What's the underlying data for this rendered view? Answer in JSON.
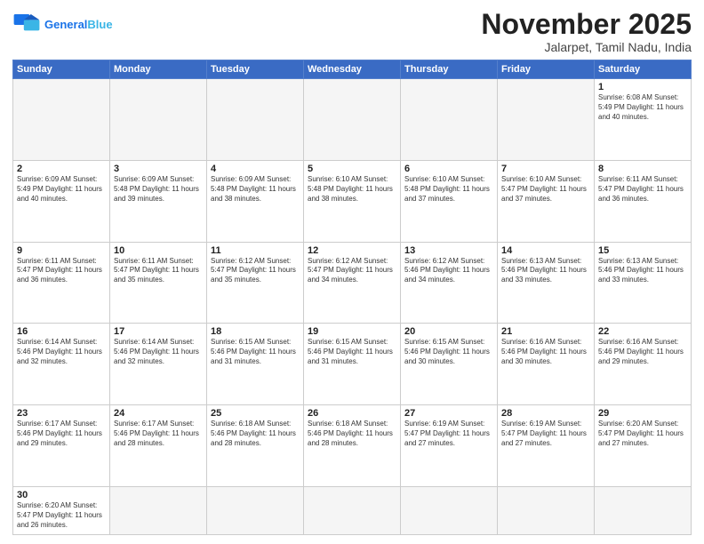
{
  "header": {
    "logo_general": "General",
    "logo_blue": "Blue",
    "month_title": "November 2025",
    "location": "Jalarpet, Tamil Nadu, India"
  },
  "days_of_week": [
    "Sunday",
    "Monday",
    "Tuesday",
    "Wednesday",
    "Thursday",
    "Friday",
    "Saturday"
  ],
  "weeks": [
    [
      {
        "day": "",
        "info": ""
      },
      {
        "day": "",
        "info": ""
      },
      {
        "day": "",
        "info": ""
      },
      {
        "day": "",
        "info": ""
      },
      {
        "day": "",
        "info": ""
      },
      {
        "day": "",
        "info": ""
      },
      {
        "day": "1",
        "info": "Sunrise: 6:08 AM\nSunset: 5:49 PM\nDaylight: 11 hours and 40 minutes."
      }
    ],
    [
      {
        "day": "2",
        "info": "Sunrise: 6:09 AM\nSunset: 5:49 PM\nDaylight: 11 hours and 40 minutes."
      },
      {
        "day": "3",
        "info": "Sunrise: 6:09 AM\nSunset: 5:48 PM\nDaylight: 11 hours and 39 minutes."
      },
      {
        "day": "4",
        "info": "Sunrise: 6:09 AM\nSunset: 5:48 PM\nDaylight: 11 hours and 38 minutes."
      },
      {
        "day": "5",
        "info": "Sunrise: 6:10 AM\nSunset: 5:48 PM\nDaylight: 11 hours and 38 minutes."
      },
      {
        "day": "6",
        "info": "Sunrise: 6:10 AM\nSunset: 5:48 PM\nDaylight: 11 hours and 37 minutes."
      },
      {
        "day": "7",
        "info": "Sunrise: 6:10 AM\nSunset: 5:47 PM\nDaylight: 11 hours and 37 minutes."
      },
      {
        "day": "8",
        "info": "Sunrise: 6:11 AM\nSunset: 5:47 PM\nDaylight: 11 hours and 36 minutes."
      }
    ],
    [
      {
        "day": "9",
        "info": "Sunrise: 6:11 AM\nSunset: 5:47 PM\nDaylight: 11 hours and 36 minutes."
      },
      {
        "day": "10",
        "info": "Sunrise: 6:11 AM\nSunset: 5:47 PM\nDaylight: 11 hours and 35 minutes."
      },
      {
        "day": "11",
        "info": "Sunrise: 6:12 AM\nSunset: 5:47 PM\nDaylight: 11 hours and 35 minutes."
      },
      {
        "day": "12",
        "info": "Sunrise: 6:12 AM\nSunset: 5:47 PM\nDaylight: 11 hours and 34 minutes."
      },
      {
        "day": "13",
        "info": "Sunrise: 6:12 AM\nSunset: 5:46 PM\nDaylight: 11 hours and 34 minutes."
      },
      {
        "day": "14",
        "info": "Sunrise: 6:13 AM\nSunset: 5:46 PM\nDaylight: 11 hours and 33 minutes."
      },
      {
        "day": "15",
        "info": "Sunrise: 6:13 AM\nSunset: 5:46 PM\nDaylight: 11 hours and 33 minutes."
      }
    ],
    [
      {
        "day": "16",
        "info": "Sunrise: 6:14 AM\nSunset: 5:46 PM\nDaylight: 11 hours and 32 minutes."
      },
      {
        "day": "17",
        "info": "Sunrise: 6:14 AM\nSunset: 5:46 PM\nDaylight: 11 hours and 32 minutes."
      },
      {
        "day": "18",
        "info": "Sunrise: 6:15 AM\nSunset: 5:46 PM\nDaylight: 11 hours and 31 minutes."
      },
      {
        "day": "19",
        "info": "Sunrise: 6:15 AM\nSunset: 5:46 PM\nDaylight: 11 hours and 31 minutes."
      },
      {
        "day": "20",
        "info": "Sunrise: 6:15 AM\nSunset: 5:46 PM\nDaylight: 11 hours and 30 minutes."
      },
      {
        "day": "21",
        "info": "Sunrise: 6:16 AM\nSunset: 5:46 PM\nDaylight: 11 hours and 30 minutes."
      },
      {
        "day": "22",
        "info": "Sunrise: 6:16 AM\nSunset: 5:46 PM\nDaylight: 11 hours and 29 minutes."
      }
    ],
    [
      {
        "day": "23",
        "info": "Sunrise: 6:17 AM\nSunset: 5:46 PM\nDaylight: 11 hours and 29 minutes."
      },
      {
        "day": "24",
        "info": "Sunrise: 6:17 AM\nSunset: 5:46 PM\nDaylight: 11 hours and 28 minutes."
      },
      {
        "day": "25",
        "info": "Sunrise: 6:18 AM\nSunset: 5:46 PM\nDaylight: 11 hours and 28 minutes."
      },
      {
        "day": "26",
        "info": "Sunrise: 6:18 AM\nSunset: 5:46 PM\nDaylight: 11 hours and 28 minutes."
      },
      {
        "day": "27",
        "info": "Sunrise: 6:19 AM\nSunset: 5:47 PM\nDaylight: 11 hours and 27 minutes."
      },
      {
        "day": "28",
        "info": "Sunrise: 6:19 AM\nSunset: 5:47 PM\nDaylight: 11 hours and 27 minutes."
      },
      {
        "day": "29",
        "info": "Sunrise: 6:20 AM\nSunset: 5:47 PM\nDaylight: 11 hours and 27 minutes."
      }
    ],
    [
      {
        "day": "30",
        "info": "Sunrise: 6:20 AM\nSunset: 5:47 PM\nDaylight: 11 hours and 26 minutes."
      },
      {
        "day": "",
        "info": ""
      },
      {
        "day": "",
        "info": ""
      },
      {
        "day": "",
        "info": ""
      },
      {
        "day": "",
        "info": ""
      },
      {
        "day": "",
        "info": ""
      },
      {
        "day": "",
        "info": ""
      }
    ]
  ]
}
